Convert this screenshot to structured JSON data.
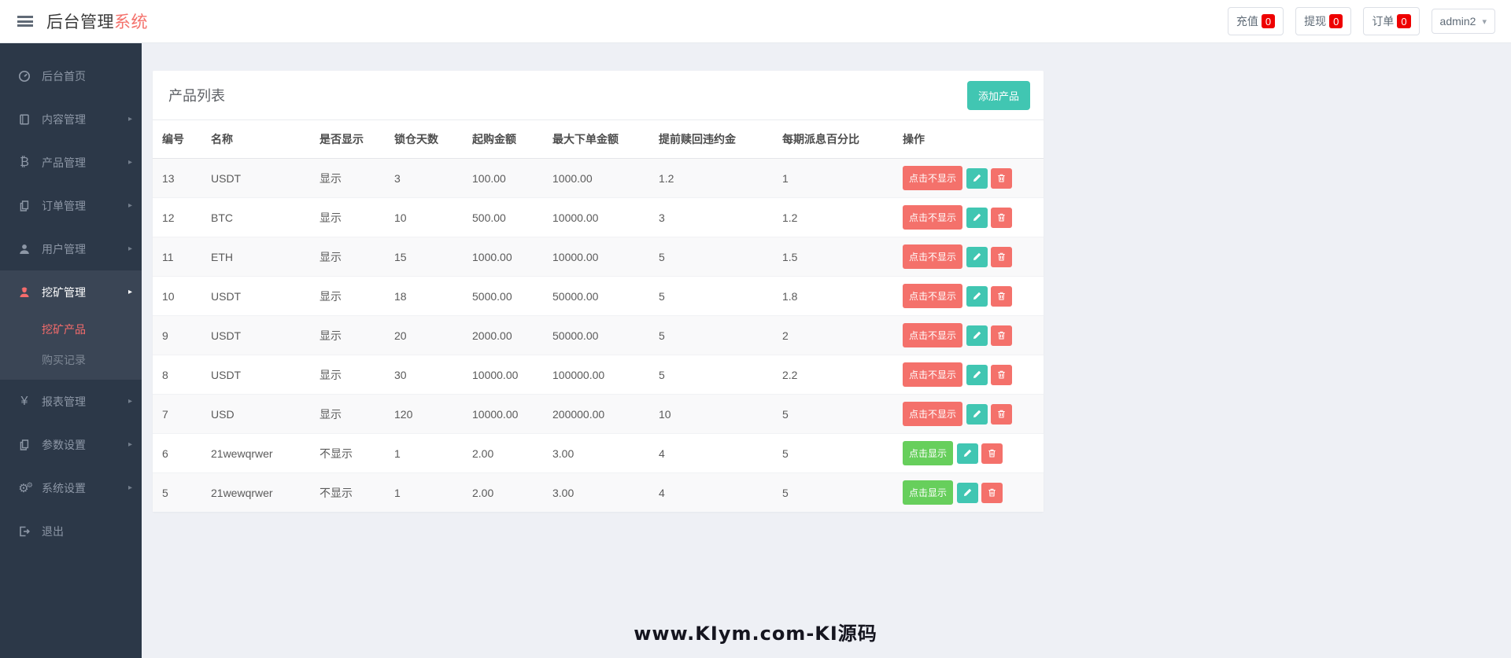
{
  "colors": {
    "accent": "#41c6b2",
    "danger": "#f4716b",
    "success": "#67cf5c",
    "badge": "#ee0000",
    "sidebar_active": "#f56c6c"
  },
  "header": {
    "brand": {
      "primary": "后台管理",
      "accent": "系统"
    },
    "quick_stats": [
      {
        "key": "recharge",
        "label": "充值",
        "badge": "0"
      },
      {
        "key": "withdraw",
        "label": "提现",
        "badge": "0"
      },
      {
        "key": "orders",
        "label": "订单",
        "badge": "0"
      }
    ],
    "user_menu": {
      "label": "admin2"
    }
  },
  "sidebar": {
    "items": [
      {
        "key": "home",
        "label": "后台首页",
        "icon": "dashboard-icon",
        "has_children": false
      },
      {
        "key": "content",
        "label": "内容管理",
        "icon": "book-icon",
        "has_children": true
      },
      {
        "key": "product",
        "label": "产品管理",
        "icon": "bitcoin-icon",
        "has_children": true
      },
      {
        "key": "order",
        "label": "订单管理",
        "icon": "files-icon",
        "has_children": true
      },
      {
        "key": "user",
        "label": "用户管理",
        "icon": "user-icon",
        "has_children": true
      },
      {
        "key": "mining",
        "label": "挖矿管理",
        "icon": "miner-icon",
        "has_children": true,
        "expanded": true,
        "children": [
          {
            "key": "mining-products",
            "label": "挖矿产品",
            "active": true
          },
          {
            "key": "purchase-records",
            "label": "购买记录",
            "active": false
          }
        ]
      },
      {
        "key": "report",
        "label": "报表管理",
        "icon": "yen-icon",
        "has_children": true
      },
      {
        "key": "params",
        "label": "参数设置",
        "icon": "files-icon",
        "has_children": true
      },
      {
        "key": "system",
        "label": "系统设置",
        "icon": "gears-icon",
        "has_children": true
      },
      {
        "key": "logout",
        "label": "退出",
        "icon": "signout-icon",
        "has_children": false
      }
    ]
  },
  "main": {
    "card": {
      "title": "产品列表",
      "add_button": "添加产品"
    },
    "table": {
      "columns": [
        "编号",
        "名称",
        "是否显示",
        "锁仓天数",
        "起购金额",
        "最大下单金额",
        "提前赎回违约金",
        "每期派息百分比",
        "操作"
      ],
      "rows": [
        {
          "id": "13",
          "name": "USDT",
          "display": "显示",
          "lock_days": "3",
          "min_buy": "100.00",
          "max_order": "1000.00",
          "penalty": "1.2",
          "dividend_pct": "1",
          "toggle": "点击不显示",
          "toggle_style": "danger"
        },
        {
          "id": "12",
          "name": "BTC",
          "display": "显示",
          "lock_days": "10",
          "min_buy": "500.00",
          "max_order": "10000.00",
          "penalty": "3",
          "dividend_pct": "1.2",
          "toggle": "点击不显示",
          "toggle_style": "danger"
        },
        {
          "id": "11",
          "name": "ETH",
          "display": "显示",
          "lock_days": "15",
          "min_buy": "1000.00",
          "max_order": "10000.00",
          "penalty": "5",
          "dividend_pct": "1.5",
          "toggle": "点击不显示",
          "toggle_style": "danger"
        },
        {
          "id": "10",
          "name": "USDT",
          "display": "显示",
          "lock_days": "18",
          "min_buy": "5000.00",
          "max_order": "50000.00",
          "penalty": "5",
          "dividend_pct": "1.8",
          "toggle": "点击不显示",
          "toggle_style": "danger"
        },
        {
          "id": "9",
          "name": "USDT",
          "display": "显示",
          "lock_days": "20",
          "min_buy": "2000.00",
          "max_order": "50000.00",
          "penalty": "5",
          "dividend_pct": "2",
          "toggle": "点击不显示",
          "toggle_style": "danger"
        },
        {
          "id": "8",
          "name": "USDT",
          "display": "显示",
          "lock_days": "30",
          "min_buy": "10000.00",
          "max_order": "100000.00",
          "penalty": "5",
          "dividend_pct": "2.2",
          "toggle": "点击不显示",
          "toggle_style": "danger"
        },
        {
          "id": "7",
          "name": "USD",
          "display": "显示",
          "lock_days": "120",
          "min_buy": "10000.00",
          "max_order": "200000.00",
          "penalty": "10",
          "dividend_pct": "5",
          "toggle": "点击不显示",
          "toggle_style": "danger"
        },
        {
          "id": "6",
          "name": "21wewqrwer",
          "display": "不显示",
          "lock_days": "1",
          "min_buy": "2.00",
          "max_order": "3.00",
          "penalty": "4",
          "dividend_pct": "5",
          "toggle": "点击显示",
          "toggle_style": "success"
        },
        {
          "id": "5",
          "name": "21wewqrwer",
          "display": "不显示",
          "lock_days": "1",
          "min_buy": "2.00",
          "max_order": "3.00",
          "penalty": "4",
          "dividend_pct": "5",
          "toggle": "点击显示",
          "toggle_style": "success"
        }
      ]
    }
  },
  "watermark": "www.KIym.com-KI源码"
}
